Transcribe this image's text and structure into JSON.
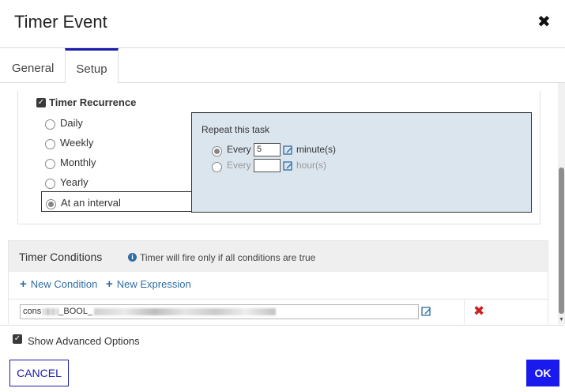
{
  "dialog": {
    "title": "Timer Event"
  },
  "tabs": [
    {
      "label": "General"
    },
    {
      "label": "Setup"
    }
  ],
  "recurrence": {
    "label": "Timer Recurrence",
    "options": [
      "Daily",
      "Weekly",
      "Monthly",
      "Yearly",
      "At an interval"
    ],
    "selected": "At an interval"
  },
  "repeat": {
    "title": "Repeat this task",
    "every_label": "Every",
    "minutes_value": "5",
    "minutes_unit": "minute(s)",
    "hours_value": "",
    "hours_unit": "hour(s)",
    "selected": "minute(s)"
  },
  "conditions": {
    "title": "Timer Conditions",
    "note": "Timer will fire only if all conditions are true",
    "new_condition": "New Condition",
    "new_expression": "New Expression",
    "expression_prefix": "cons",
    "expression_mid": "_BOOL_"
  },
  "footer": {
    "show_advanced": "Show Advanced Options",
    "cancel": "CANCEL",
    "ok": "OK"
  },
  "colors": {
    "accent": "#1a1aee",
    "link": "#2f6da3",
    "delete": "#cc1f1f",
    "panel": "#dbe5ee"
  }
}
